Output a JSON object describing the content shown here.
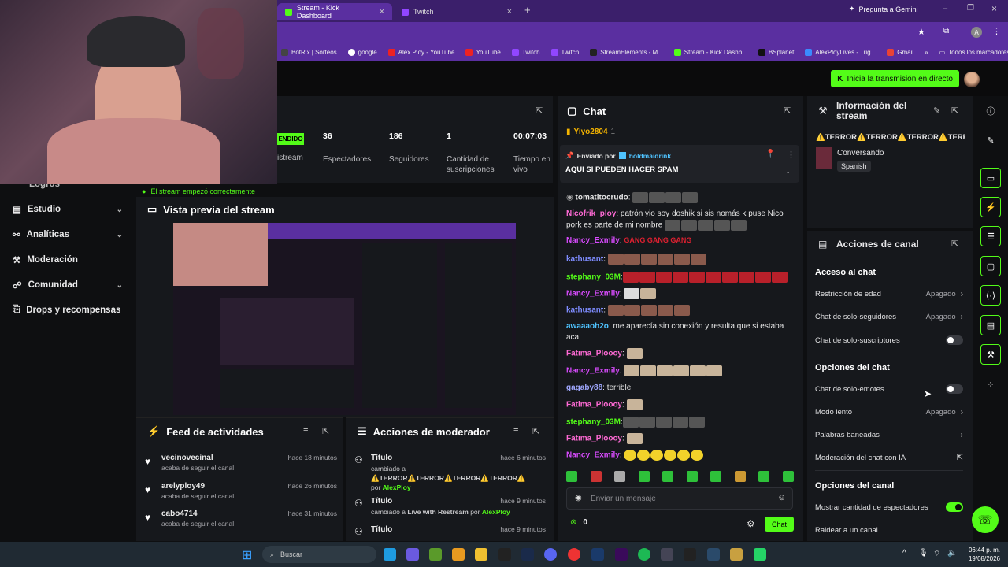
{
  "browser": {
    "tabs": [
      {
        "label": "Stream - Kick Dashboard",
        "active": true
      },
      {
        "label": "Twitch",
        "active": false
      }
    ],
    "gemini_label": "Pregunta a Gemini",
    "profile_initial": "A",
    "bookmarks": [
      "BotRix | Sorteos",
      "google",
      "Alex Ploy - YouTube",
      "YouTube",
      "Twitch",
      "Twitch",
      "StreamElements - M...",
      "Stream - Kick Dashb...",
      "BSplanet",
      "AlexPloyLives - Trig...",
      "Gmail"
    ],
    "bookmarks_more": "»",
    "all_bookmarks": "Todos los marcadores"
  },
  "header": {
    "go_live_label": "Inicia la transmisión en directo"
  },
  "nav": {
    "partial_label": "Logros",
    "items": [
      {
        "label": "Estudio",
        "has_chevron": true
      },
      {
        "label": "Analíticas",
        "has_chevron": true
      },
      {
        "label": "Moderación",
        "has_chevron": false
      },
      {
        "label": "Comunidad",
        "has_chevron": true
      },
      {
        "label": "Drops y recompensas",
        "has_chevron": false
      }
    ]
  },
  "stats": {
    "status_badge": "ENDIDO",
    "status_label": "istream",
    "viewers_value": "36",
    "viewers_label": "Espectadores",
    "followers_value": "186",
    "followers_label": "Seguidores",
    "subs_value": "1",
    "subs_label": "Cantidad de suscripciones",
    "uptime_value": "00:07:03",
    "uptime_label": "Tiempo en vivo",
    "toast": "El stream empezó correctamente"
  },
  "preview": {
    "title": "Vista previa del stream"
  },
  "feed": {
    "title": "Feed de actividades",
    "items": [
      {
        "name": "vecinovecinal",
        "action": "acaba de seguir el canal",
        "time": "hace 18 minutos"
      },
      {
        "name": "arelyploy49",
        "action": "acaba de seguir el canal",
        "time": "hace 26 minutos"
      },
      {
        "name": "cabo4714",
        "action": "acaba de seguir el canal",
        "time": "hace 31 minutos"
      }
    ]
  },
  "mod_actions": {
    "title": "Acciones de moderador",
    "items": [
      {
        "title": "Título",
        "time": "hace 6 minutos",
        "line1": "cambiado a",
        "line2": "⚠️TERROR⚠️TERROR⚠️TERROR⚠️TERROR⚠️",
        "line3_prefix": "por",
        "by": "AlexPloy"
      },
      {
        "title": "Título",
        "time": "hace 9 minutos",
        "line1": "cambiado a",
        "value": "Live with Restream",
        "line3_prefix": "por",
        "by": "AlexPloy"
      },
      {
        "title": "Título",
        "time": "hace 9 minutos"
      }
    ]
  },
  "chat": {
    "title": "Chat",
    "top_user": "Yiyo2804",
    "top_count": "1",
    "pinned_sent_by_label": "Enviado por",
    "pinned_user": "holdmaidrink",
    "pinned_message": "AQUI SI PUEDEN HACER SPAM",
    "messages": [
      {
        "user": "tomatitocrudo",
        "color": "#ffffff",
        "text": ""
      },
      {
        "user": "Nicofrik_ploy",
        "color": "#ff6ad5",
        "text": "patrón yio soy doshik si sis nomás k puse Nico pork es parte de mi nombre"
      },
      {
        "user": "Nancy_Exmily",
        "color": "#d94bff",
        "text": "GANG GANG GANG"
      },
      {
        "user": "kathusant",
        "color": "#7e8cff",
        "text": ""
      },
      {
        "user": "stephany_03M",
        "color": "#53fc18",
        "text": ""
      },
      {
        "user": "Nancy_Exmily",
        "color": "#d94bff",
        "text": ""
      },
      {
        "user": "kathusant",
        "color": "#7e8cff",
        "text": ""
      },
      {
        "user": "awaaaoh2o",
        "color": "#4fc3ff",
        "text": "me aparecía sin conexión y resulta que si estaba aca"
      },
      {
        "user": "Fatima_Plooоу",
        "color": "#ff6ad5",
        "text": ""
      },
      {
        "user": "Nancy_Exmily",
        "color": "#d94bff",
        "text": ""
      },
      {
        "user": "gagaby88",
        "color": "#a0a8ff",
        "text": "terrible"
      },
      {
        "user": "Fatima_Plooоу",
        "color": "#ff6ad5",
        "text": ""
      },
      {
        "user": "stephany_03M",
        "color": "#53fc18",
        "text": ""
      },
      {
        "user": "Fatima_Plooоу",
        "color": "#ff6ad5",
        "text": ""
      },
      {
        "user": "Nancy_Exmily",
        "color": "#d94bff",
        "text": ""
      }
    ],
    "input_placeholder": "Enviar un mensaje",
    "points": "0",
    "send_label": "Chat"
  },
  "info": {
    "title": "Información del stream",
    "stream_title": "⚠️TERROR⚠️TERROR⚠️TERROR⚠️TERR",
    "category": "Conversando",
    "language": "Spanish"
  },
  "channel_actions": {
    "title": "Acciones de canal",
    "chat_access_heading": "Acceso al chat",
    "age_restriction": "Restricción de edad",
    "age_restriction_value": "Apagado",
    "followers_only": "Chat de solo-seguidores",
    "followers_only_value": "Apagado",
    "subs_only": "Chat de solo-suscriptores",
    "chat_options_heading": "Opciones del chat",
    "emotes_only": "Chat de solo-emotes",
    "slow_mode": "Modo lento",
    "slow_mode_value": "Apagado",
    "banned_words": "Palabras baneadas",
    "ai_moderation": "Moderación del chat con IA",
    "channel_options_heading": "Opciones del canal",
    "show_viewers": "Mostrar cantidad de espectadores",
    "raid": "Raidear a un canal"
  },
  "taskbar": {
    "search_placeholder": "Buscar",
    "time": "06:44 p. m.",
    "date": "19/08/2026"
  },
  "colors": {
    "accent": "#53fc18",
    "browser_purple": "#5a2fa0",
    "panel_bg": "#16181c"
  }
}
